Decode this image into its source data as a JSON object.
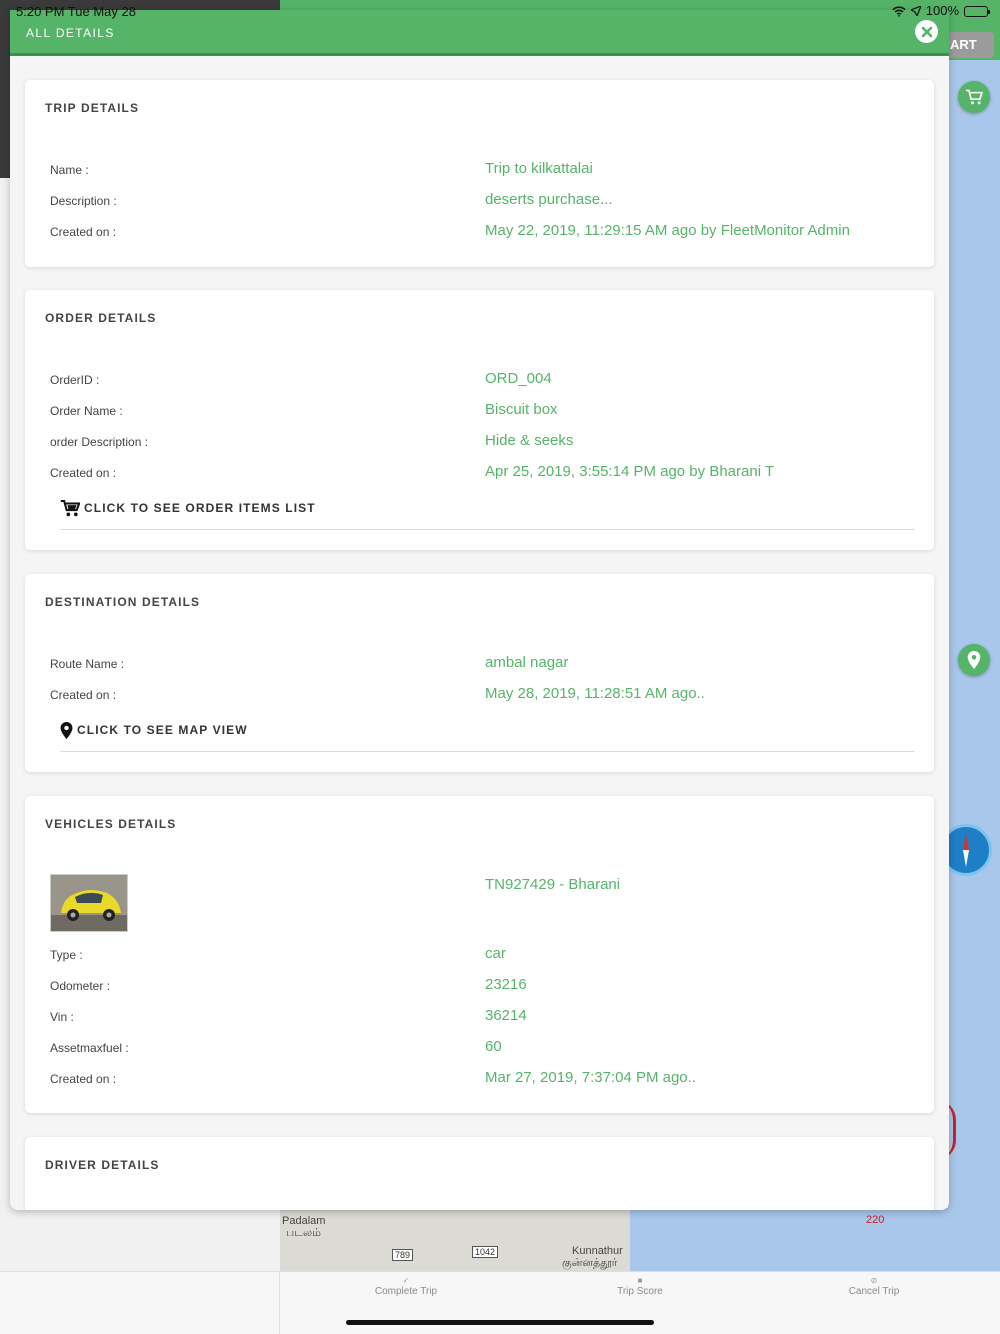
{
  "status_bar": {
    "time": "5:20 PM   Tue May 28",
    "battery": "100%"
  },
  "background": {
    "start_button": "ART",
    "map_labels": {
      "padalam": "Padalam",
      "padalam_tamil": "படலம்",
      "kunnathur": "Kunnathur",
      "kunnathur_tamil": "குன்னத்தூர்",
      "road_789": "789",
      "road_1042": "1042",
      "marker_220": "220"
    }
  },
  "tabbar": {
    "complete_trip": "Complete Trip",
    "trip_score": "Trip Score",
    "cancel_trip": "Cancel Trip"
  },
  "modal": {
    "title": "ALL DETAILS"
  },
  "trip": {
    "title": "TRIP DETAILS",
    "rows": [
      {
        "label": "Name :",
        "value": "Trip to kilkattalai"
      },
      {
        "label": "Description :",
        "value": "deserts purchase..."
      },
      {
        "label": "Created on :",
        "value": "May 22, 2019, 11:29:15 AM ago by FleetMonitor Admin"
      }
    ]
  },
  "order": {
    "title": "ORDER DETAILS",
    "rows": [
      {
        "label": "OrderID :",
        "value": "ORD_004"
      },
      {
        "label": "Order Name :",
        "value": "Biscuit box"
      },
      {
        "label": "order Description :",
        "value": "Hide & seeks"
      },
      {
        "label": "Created on :",
        "value": "Apr 25, 2019, 3:55:14 PM ago by Bharani T"
      }
    ],
    "link": "CLICK TO SEE ORDER ITEMS LIST"
  },
  "destination": {
    "title": "DESTINATION DETAILS",
    "rows": [
      {
        "label": "Route Name :",
        "value": "ambal nagar"
      },
      {
        "label": "Created on :",
        "value": "May 28, 2019, 11:28:51 AM ago.."
      }
    ],
    "link": "CLICK TO SEE MAP VIEW"
  },
  "vehicles": {
    "title": "VEHICLES DETAILS",
    "vehicle_name": "TN927429 - Bharani",
    "rows": [
      {
        "label": "Type :",
        "value": "car"
      },
      {
        "label": "Odometer :",
        "value": "23216"
      },
      {
        "label": "Vin :",
        "value": "36214"
      },
      {
        "label": "Assetmaxfuel :",
        "value": "60"
      },
      {
        "label": "Created on :",
        "value": "Mar 27, 2019, 7:37:04 PM ago.."
      }
    ]
  },
  "driver": {
    "title": "DRIVER DETAILS"
  },
  "colors": {
    "accent_green": "#55b467",
    "label_gray": "#444444"
  }
}
